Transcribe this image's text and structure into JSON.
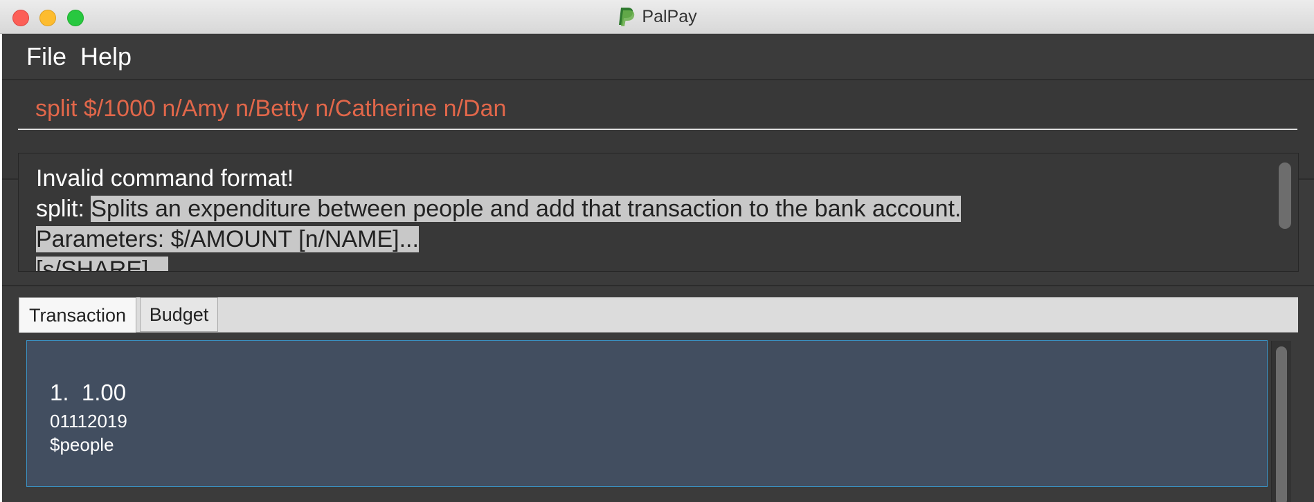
{
  "window": {
    "title": "PalPay"
  },
  "menu": {
    "file": "File",
    "help": "Help"
  },
  "command": {
    "value": "split $/1000 n/Amy n/Betty n/Catherine n/Dan"
  },
  "result": {
    "line1": "Invalid command format!",
    "line2_prefix": "split: ",
    "line2_highlight": "Splits an expenditure between people and add that transaction to the bank account.",
    "line3": "Parameters: $/AMOUNT [n/NAME]...",
    "line4": "[s/SHARE]..."
  },
  "tabs": {
    "transaction": "Transaction",
    "budget": "Budget"
  },
  "transactions": [
    {
      "index": "1.",
      "amount": "1.00",
      "date": "01112019",
      "description": "$people"
    }
  ],
  "colors": {
    "command_text": "#e2674a",
    "card_background": "#424e60",
    "card_border": "#3a91c3",
    "app_background": "#3b3b3b"
  },
  "icons": {
    "app_logo": "paypal-logo-icon"
  }
}
